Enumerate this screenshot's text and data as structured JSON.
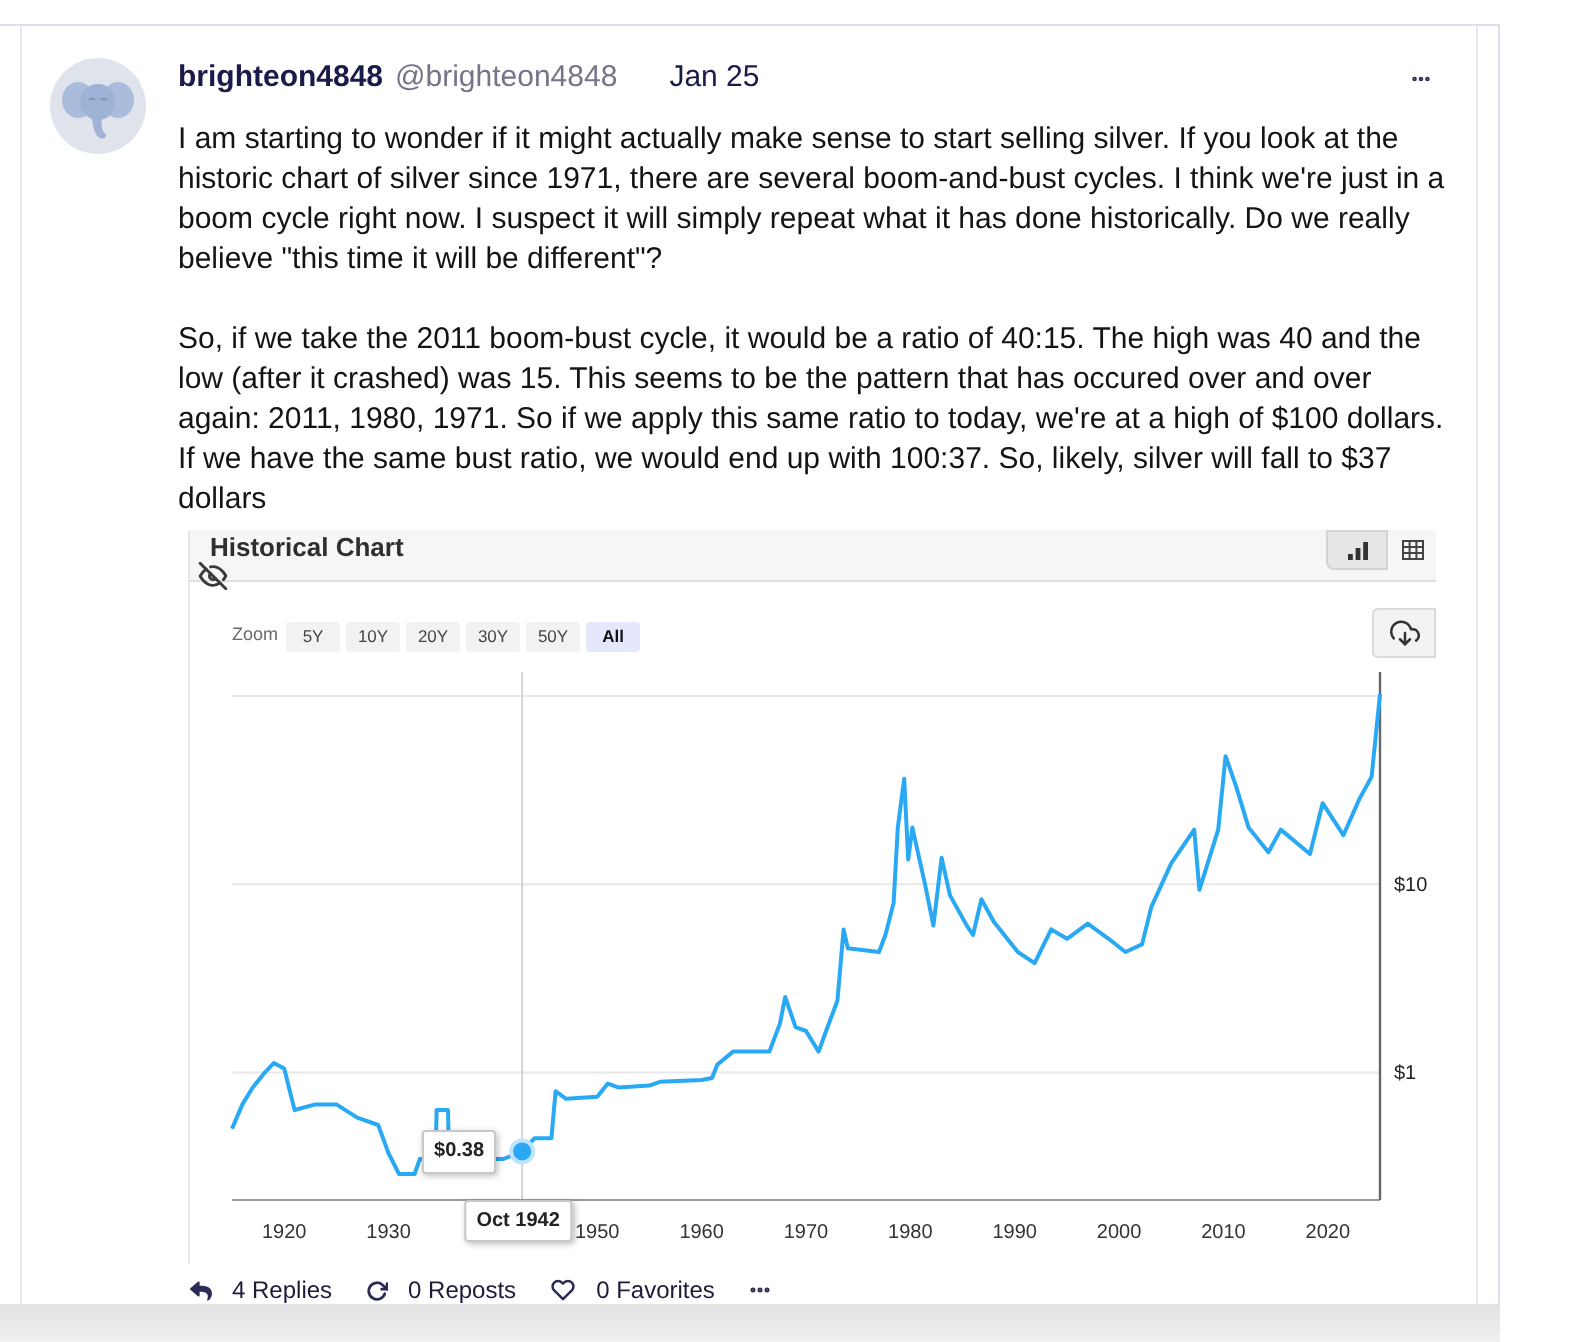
{
  "post": {
    "author": {
      "name": "brighteon4848",
      "handle": "@brighteon4848"
    },
    "date": "Jan 25",
    "paragraphs": [
      "I am starting to wonder if it might actually make sense to start selling silver. If you look at the historic chart of silver since 1971, there are several boom-and-bust cycles. I think we're just in a boom cycle right now. I suspect it will simply repeat what it has done historically. Do we really believe \"this time it will be different\"?",
      "So, if we take the 2011 boom-bust cycle, it would be a ratio of 40:15. The high was 40 and the low (after it crashed) was 15. This seems to be the pattern that has occured over and over again: 2011, 1980, 1971. So if we apply this same ratio to today, we're at a high of $100 dollars. If we have the same bust ratio, we would end up with 100:37. So, likely, silver will fall to $37 dollars"
    ],
    "chart": {
      "title": "Historical Chart",
      "views": [
        {
          "kind": "chart",
          "selected": true
        },
        {
          "kind": "table",
          "selected": false
        }
      ],
      "zoom_label": "Zoom",
      "zoom_options": [
        {
          "label": "5Y",
          "selected": false
        },
        {
          "label": "10Y",
          "selected": false
        },
        {
          "label": "20Y",
          "selected": false
        },
        {
          "label": "30Y",
          "selected": false
        },
        {
          "label": "50Y",
          "selected": false
        },
        {
          "label": "All",
          "selected": true
        }
      ],
      "plot": {
        "y_axis_labels": [
          "$10",
          "$1"
        ],
        "x_axis_labels": [
          "1920",
          "1930",
          "1950",
          "1960",
          "1970",
          "1980",
          "1990",
          "2000",
          "2010",
          "2020"
        ],
        "tooltip": {
          "value": "$0.38",
          "date": "Oct 1942"
        }
      }
    },
    "actions": [
      {
        "kind": "reply",
        "label": "4 Replies"
      },
      {
        "kind": "repost",
        "label": "0 Reposts"
      },
      {
        "kind": "favorite",
        "label": "0 Favorites"
      },
      {
        "kind": "more"
      }
    ]
  }
}
